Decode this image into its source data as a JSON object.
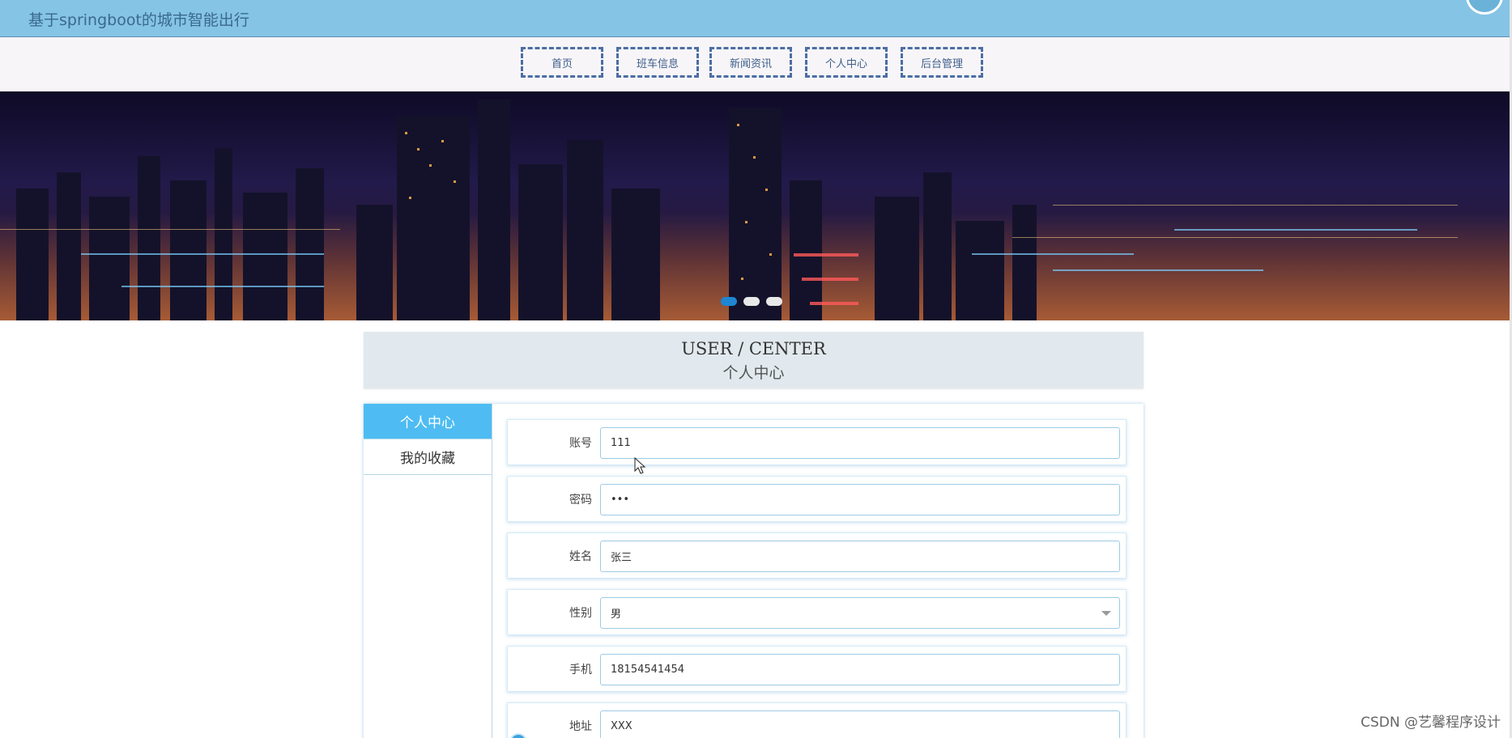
{
  "header": {
    "site_title": "基于springboot的城市智能出行"
  },
  "nav": {
    "items": [
      {
        "label": "首页"
      },
      {
        "label": "班车信息"
      },
      {
        "label": "新闻资讯"
      },
      {
        "label": "个人中心"
      },
      {
        "label": "后台管理"
      }
    ]
  },
  "banner": {
    "active_slide": 1,
    "slide_count": 3
  },
  "section": {
    "title_en": "USER / CENTER",
    "title_cn": "个人中心"
  },
  "sidebar": {
    "items": [
      {
        "label": "个人中心",
        "active": true
      },
      {
        "label": "我的收藏",
        "active": false
      }
    ]
  },
  "form": {
    "account": {
      "label": "账号",
      "value": "111"
    },
    "password": {
      "label": "密码",
      "value": "•••"
    },
    "name": {
      "label": "姓名",
      "value": "张三"
    },
    "gender": {
      "label": "性别",
      "value": "男"
    },
    "phone": {
      "label": "手机",
      "value": "18154541454"
    },
    "address": {
      "label": "地址",
      "value": "XXX"
    }
  },
  "watermark": "CSDN @艺馨程序设计",
  "colors": {
    "topbar": "#85c4e4",
    "nav_border": "#4b6ea4",
    "sidebar_active": "#4ebcf2",
    "input_border": "#9fcbe6"
  }
}
